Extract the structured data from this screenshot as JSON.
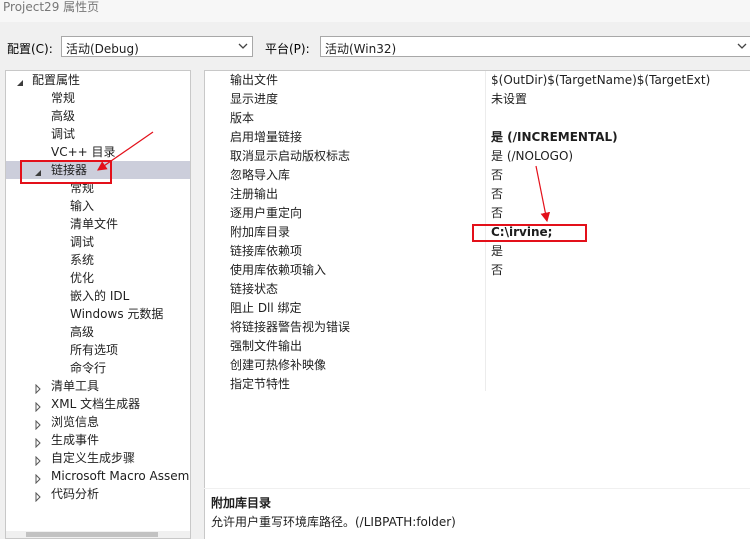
{
  "window": {
    "title": "Project29 属性页"
  },
  "toolbar": {
    "config_label": "配置(C):",
    "config_value": "活动(Debug)",
    "platform_label": "平台(P):",
    "platform_value": "活动(Win32)"
  },
  "tree": {
    "items": [
      {
        "label": "配置属性",
        "expanded": true
      },
      {
        "label": "常规"
      },
      {
        "label": "高级"
      },
      {
        "label": "调试"
      },
      {
        "label": "VC++ 目录"
      },
      {
        "label": "链接器",
        "expanded": true,
        "selected": true
      },
      {
        "label": "常规"
      },
      {
        "label": "输入"
      },
      {
        "label": "清单文件"
      },
      {
        "label": "调试"
      },
      {
        "label": "系统"
      },
      {
        "label": "优化"
      },
      {
        "label": "嵌入的 IDL"
      },
      {
        "label": "Windows 元数据"
      },
      {
        "label": "高级"
      },
      {
        "label": "所有选项"
      },
      {
        "label": "命令行"
      },
      {
        "label": "清单工具",
        "expanded": false
      },
      {
        "label": "XML 文档生成器",
        "expanded": false
      },
      {
        "label": "浏览信息",
        "expanded": false
      },
      {
        "label": "生成事件",
        "expanded": false
      },
      {
        "label": "自定义生成步骤",
        "expanded": false
      },
      {
        "label": "Microsoft Macro Assem",
        "expanded": false
      },
      {
        "label": "代码分析",
        "expanded": false
      }
    ]
  },
  "properties": [
    {
      "name": "输出文件",
      "value": "$(OutDir)$(TargetName)$(TargetExt)"
    },
    {
      "name": "显示进度",
      "value": "未设置"
    },
    {
      "name": "版本",
      "value": ""
    },
    {
      "name": "启用增量链接",
      "value": "是 (/INCREMENTAL)",
      "bold": true
    },
    {
      "name": "取消显示启动版权标志",
      "value": "是 (/NOLOGO)"
    },
    {
      "name": "忽略导入库",
      "value": "否"
    },
    {
      "name": "注册输出",
      "value": "否"
    },
    {
      "name": "逐用户重定向",
      "value": "否"
    },
    {
      "name": "附加库目录",
      "value": "C:\\irvine;",
      "bold": true
    },
    {
      "name": "链接库依赖项",
      "value": "是"
    },
    {
      "name": "使用库依赖项输入",
      "value": "否"
    },
    {
      "name": "链接状态",
      "value": ""
    },
    {
      "name": "阻止 Dll 绑定",
      "value": ""
    },
    {
      "name": "将链接器警告视为错误",
      "value": ""
    },
    {
      "name": "强制文件输出",
      "value": ""
    },
    {
      "name": "创建可热修补映像",
      "value": ""
    },
    {
      "name": "指定节特性",
      "value": ""
    }
  ],
  "description": {
    "title": "附加库目录",
    "text": "允许用户重写环境库路径。(/LIBPATH:folder)"
  },
  "colors": {
    "annotation": "#e3101a",
    "selection": "#cccedb"
  }
}
